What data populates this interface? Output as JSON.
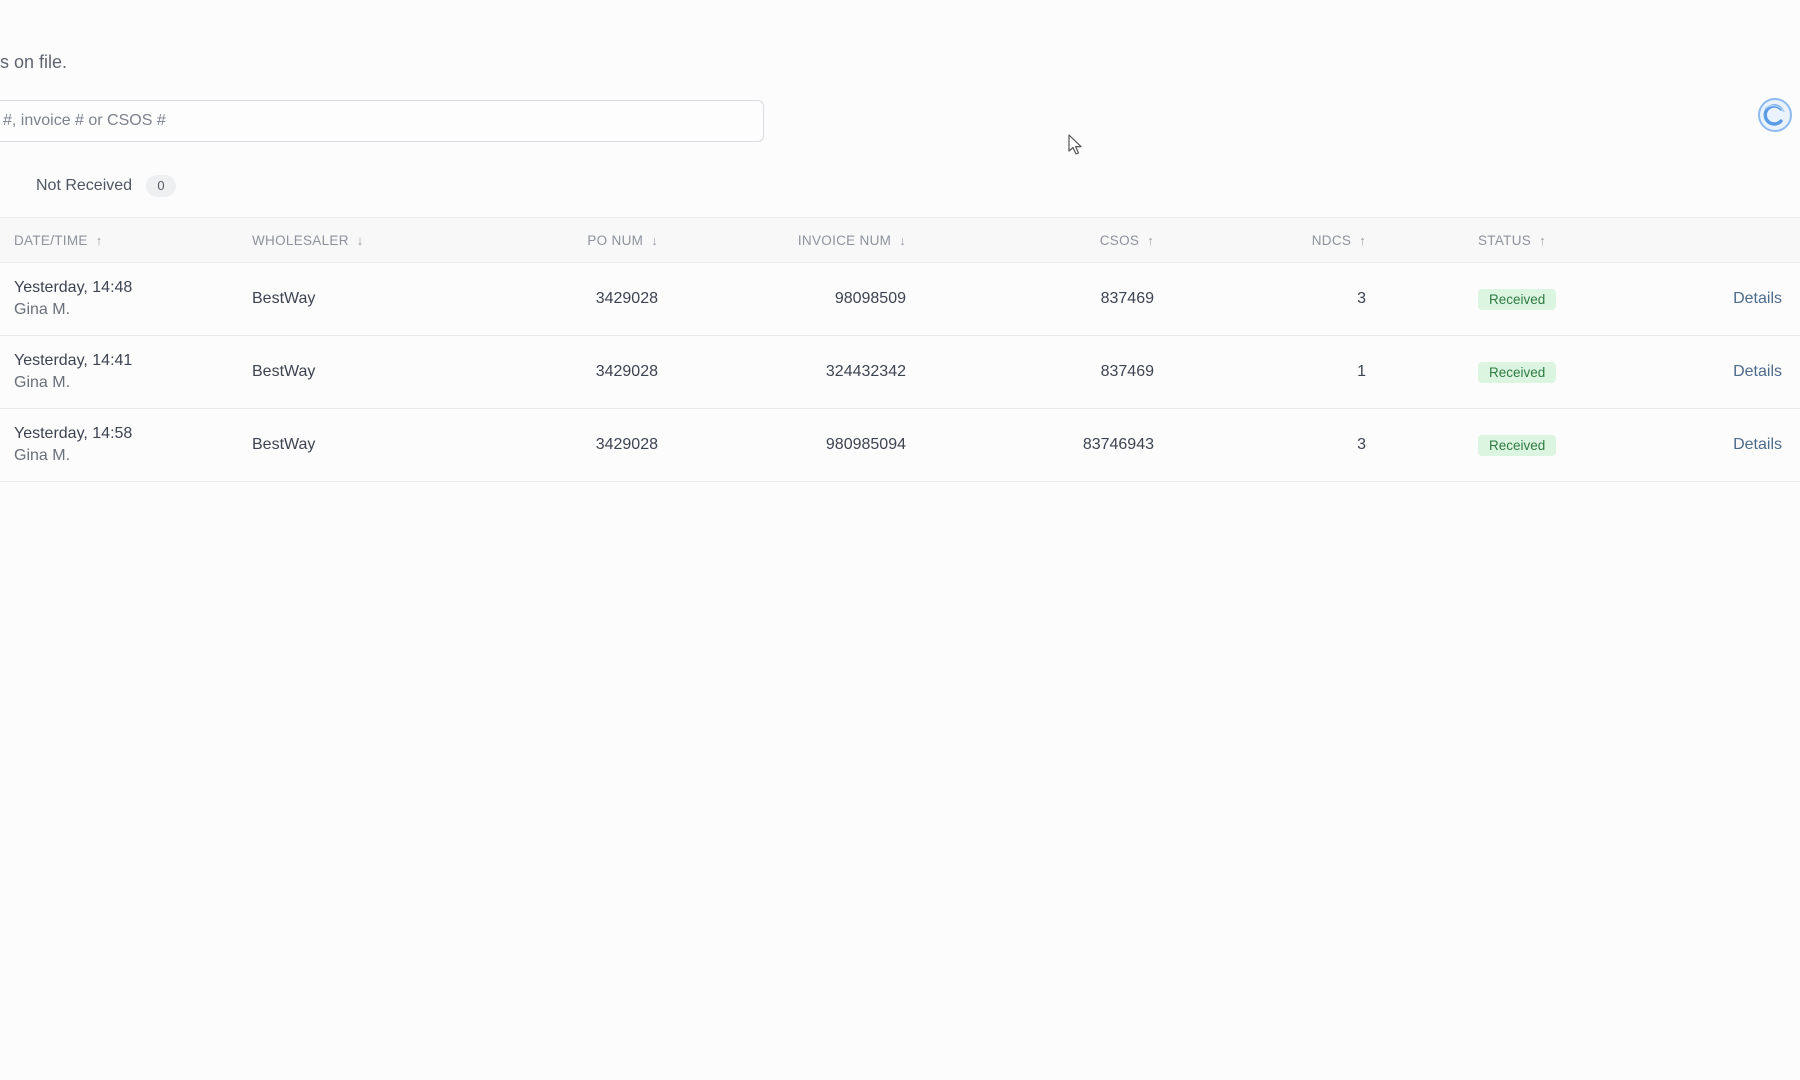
{
  "header": {
    "subtitle_fragment": "s on file."
  },
  "search": {
    "placeholder": "#, invoice # or CSOS #",
    "value": ""
  },
  "filters": {
    "not_received_label": "Not Received",
    "not_received_count": "0"
  },
  "table": {
    "columns": {
      "datetime": "DATE/TIME",
      "wholesaler": "WHOLESALER",
      "po_num": "PO NUM",
      "invoice_num": "INVOICE NUM",
      "csos": "CSOS",
      "ndcs": "NDCS",
      "status": "STATUS"
    },
    "sort": {
      "datetime": "↑",
      "wholesaler": "↓",
      "po_num": "↓",
      "invoice_num": "↓",
      "csos": "↑",
      "ndcs": "↑",
      "status": "↑"
    },
    "rows": [
      {
        "time": "Yesterday, 14:48",
        "user": "Gina M.",
        "wholesaler": "BestWay",
        "po_num": "3429028",
        "invoice_num": "98098509",
        "csos": "837469",
        "ndcs": "3",
        "status": "Received",
        "action": "Details"
      },
      {
        "time": "Yesterday, 14:41",
        "user": "Gina M.",
        "wholesaler": "BestWay",
        "po_num": "3429028",
        "invoice_num": "324432342",
        "csos": "837469",
        "ndcs": "1",
        "status": "Received",
        "action": "Details"
      },
      {
        "time": "Yesterday, 14:58",
        "user": "Gina M.",
        "wholesaler": "BestWay",
        "po_num": "3429028",
        "invoice_num": "980985094",
        "csos": "83746943",
        "ndcs": "3",
        "status": "Received",
        "action": "Details"
      }
    ]
  },
  "icons": {
    "brand": "brand-logo-icon",
    "cursor": "mouse-cursor-icon",
    "sort": "sort-arrow-icon"
  },
  "colors": {
    "status_received_bg": "#dcf5e1",
    "status_received_text": "#2f7a43",
    "link": "#4d6b8c",
    "brand": "#5b9be6"
  }
}
